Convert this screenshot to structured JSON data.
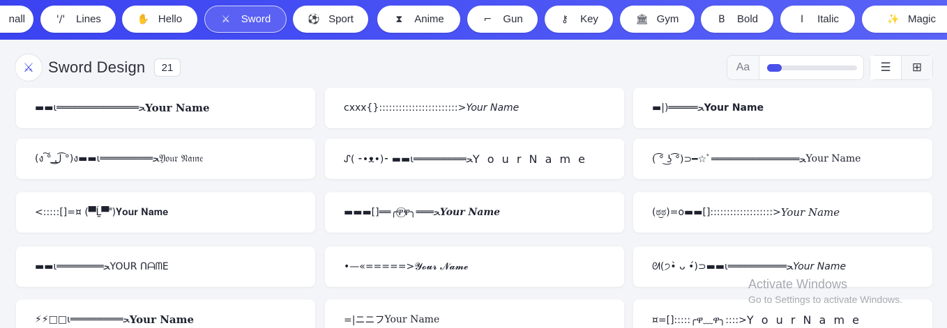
{
  "categories": [
    {
      "label": "nall",
      "icon": "",
      "active": false
    },
    {
      "label": "Lines",
      "icon": "'/'",
      "active": false
    },
    {
      "label": "Hello",
      "icon": "✋",
      "active": false
    },
    {
      "label": "Sword",
      "icon": "⚔",
      "active": true
    },
    {
      "label": "Sport",
      "icon": "⚽",
      "active": false
    },
    {
      "label": "Anime",
      "icon": "⧗",
      "active": false
    },
    {
      "label": "Gun",
      "icon": "⌐",
      "active": false
    },
    {
      "label": "Key",
      "icon": "⚷",
      "active": false
    },
    {
      "label": "Gym",
      "icon": "🏛",
      "active": false
    },
    {
      "label": "Bold",
      "icon": "B",
      "active": false
    },
    {
      "label": "Italic",
      "icon": "I",
      "active": false
    },
    {
      "label": "Magic",
      "icon": "✨",
      "active": false
    }
  ],
  "section": {
    "icon": "⚔",
    "title": "Sword Design",
    "count": "21"
  },
  "font_size_control": {
    "label": "Aa",
    "value_fraction": 0.16
  },
  "view_toggle": {
    "list_icon": "☰",
    "grid_icon": "⊞"
  },
  "designs": [
    {
      "prefix": "▬▬ι══════════════ﺤ",
      "name": "Your Name",
      "style": "s-bold-serif"
    },
    {
      "prefix": "cxxx{}::::::::::::::::::::::::>",
      "name": "Your Name",
      "style": "s-italic"
    },
    {
      "prefix": "▬|)═════ﺤ",
      "name": "Your Name",
      "style": "s-bold"
    },
    {
      "prefix": "(ง ͠° ͟ل͜ ͡°)ง▬▬ι═════════ﺤ",
      "name": "𝔜𝔬𝔲𝔯 𝔑𝔞𝔪𝔢",
      "style": ""
    },
    {
      "prefix": "ᔑ( ⁃•ᴥ•)⁃ ▬▬ι═════════ﺤ",
      "name": "Y o u r  N a m e",
      "style": "s-spaced"
    },
    {
      "prefix": "( ͡° ͜ʖ ͡°)⊃━☆ﾟ═══════════════ﺤ",
      "name": "Your Name",
      "style": "s-serif"
    },
    {
      "prefix": "<:::::[]=¤ (▀̿Ĺ̯▀̿ ̿)",
      "name": "𝐘𝐨𝐮𝐫 𝐍𝐚𝐦𝐞",
      "style": "s-serif"
    },
    {
      "prefix": "▬▬▬[]══╭ዋ⃝ዋ╮═══ﺤ",
      "name": "Your Name",
      "style": "s-bold-italic-serif"
    },
    {
      "prefix": "(ಠ͜ಠ)=o▬▬[]:::::::::::::::::::>",
      "name": "Your Name",
      "style": "s-italic-serif"
    },
    {
      "prefix": "▬▬ι════════ﺤ",
      "name": "YOUR ՈᗩᗰE",
      "style": ""
    },
    {
      "prefix": "•—«=====>",
      "name": "𝓨𝓸𝓾𝓻 𝓝𝓪𝓶𝓮",
      "style": ""
    },
    {
      "prefix": "ᘛ(੭•̀ ᴗ •́)⊃▬▬ι══════════ﺤ",
      "name": "Your Name",
      "style": "s-italic"
    },
    {
      "prefix": "⚡⚡□□ι═════════ﺤ",
      "name": "Your Name",
      "style": "s-bold-serif"
    },
    {
      "prefix": "=|ニニフ",
      "name": "Your Name",
      "style": "s-serif"
    },
    {
      "prefix": "¤=[]:::::╭ዋ﹏ዋ╮::::>",
      "name": "Y o u r  N a m e",
      "style": "s-spaced"
    }
  ],
  "watermark": {
    "title": "Activate Windows",
    "subtitle": "Go to Settings to activate Windows."
  }
}
